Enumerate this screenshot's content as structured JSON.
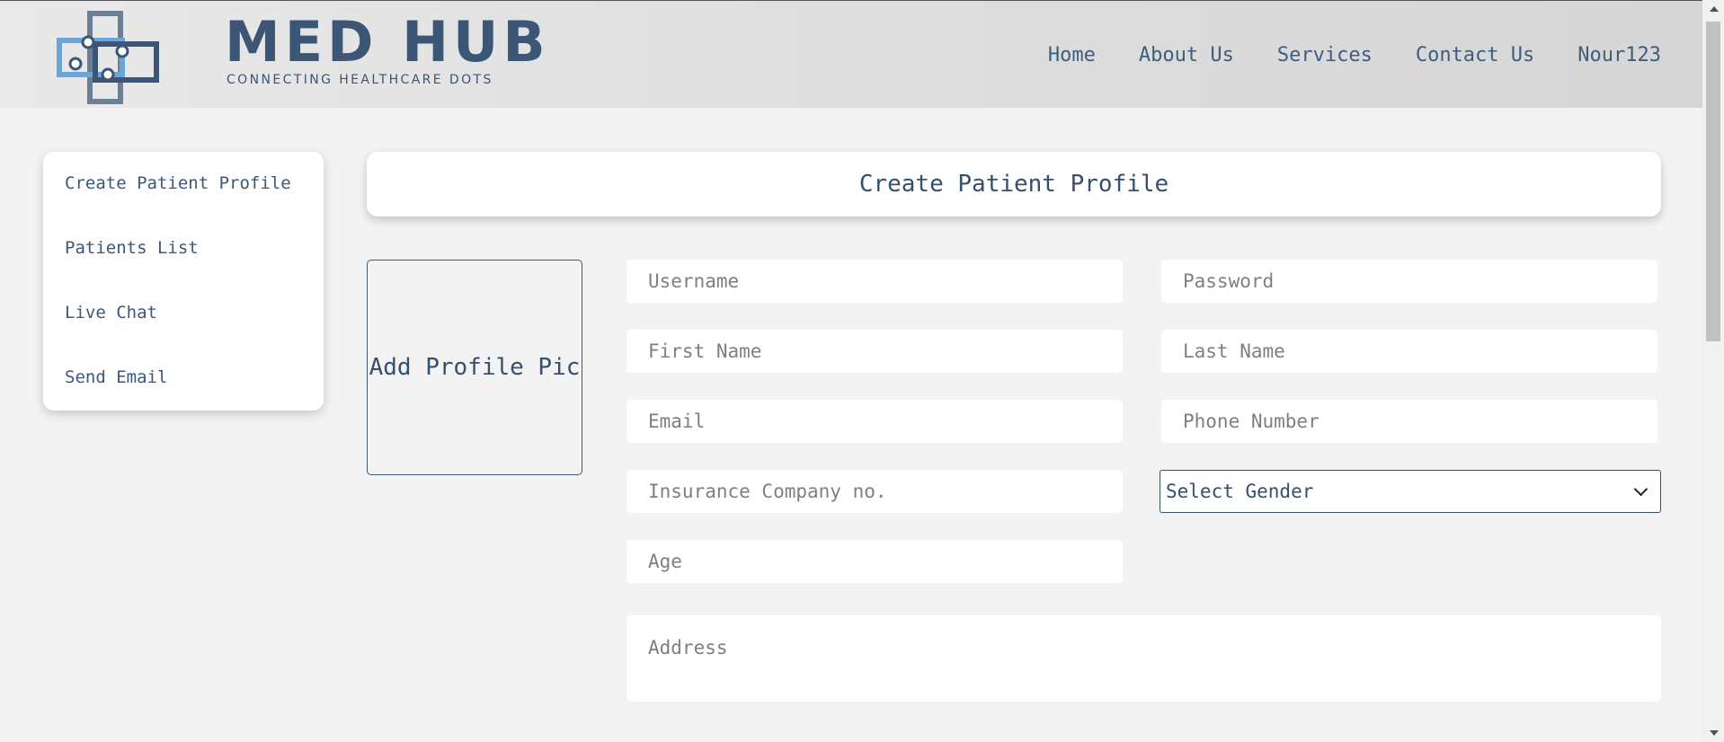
{
  "brand": {
    "name": "MED HUB",
    "tagline": "CONNECTING HEALTHCARE DOTS"
  },
  "nav": {
    "home": "Home",
    "about": "About Us",
    "services": "Services",
    "contact": "Contact Us",
    "user": "Nour123"
  },
  "sidebar": {
    "items": [
      {
        "label": "Create Patient Profile"
      },
      {
        "label": "Patients List"
      },
      {
        "label": "Live Chat"
      },
      {
        "label": "Send Email"
      }
    ]
  },
  "main": {
    "title": "Create Patient Profile",
    "profile_pic_label": "Add Profile Pic"
  },
  "form": {
    "username": {
      "placeholder": "Username",
      "value": ""
    },
    "password": {
      "placeholder": "Password",
      "value": ""
    },
    "first_name": {
      "placeholder": "First Name",
      "value": ""
    },
    "last_name": {
      "placeholder": "Last Name",
      "value": ""
    },
    "email": {
      "placeholder": "Email",
      "value": ""
    },
    "phone": {
      "placeholder": "Phone Number",
      "value": ""
    },
    "insurance": {
      "placeholder": "Insurance Company no.",
      "value": ""
    },
    "gender": {
      "selected": "Select Gender"
    },
    "age": {
      "placeholder": "Age",
      "value": ""
    },
    "address": {
      "placeholder": "Address",
      "value": ""
    }
  },
  "colors": {
    "primary": "#34506f",
    "logo_light": "#6aa6d8",
    "logo_dark": "#3c5675",
    "background": "#f3f3f3"
  }
}
